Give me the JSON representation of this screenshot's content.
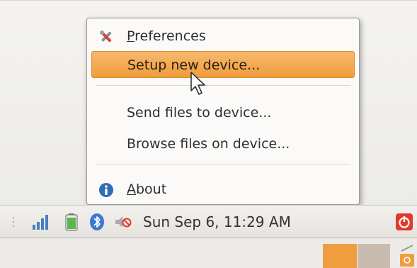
{
  "menu": {
    "items": [
      {
        "label_first": "P",
        "label_rest": "references",
        "icon": "tools-icon"
      },
      {
        "label": "Setup new device...",
        "highlighted": true
      },
      {
        "label": "Send files to device..."
      },
      {
        "label": "Browse files on device..."
      },
      {
        "label_first": "A",
        "label_rest": "bout",
        "icon": "info-icon"
      }
    ]
  },
  "panel": {
    "clock": "Sun Sep  6, 11:29 AM",
    "tray_icons": [
      "network-signal-icon",
      "battery-icon",
      "bluetooth-icon",
      "volume-muted-icon"
    ],
    "power_icon": "power-icon"
  },
  "colors": {
    "highlight": "#f0a040",
    "info_blue": "#2f6db5",
    "bluetooth_blue": "#3a78d4",
    "power_red": "#e03a2a"
  }
}
